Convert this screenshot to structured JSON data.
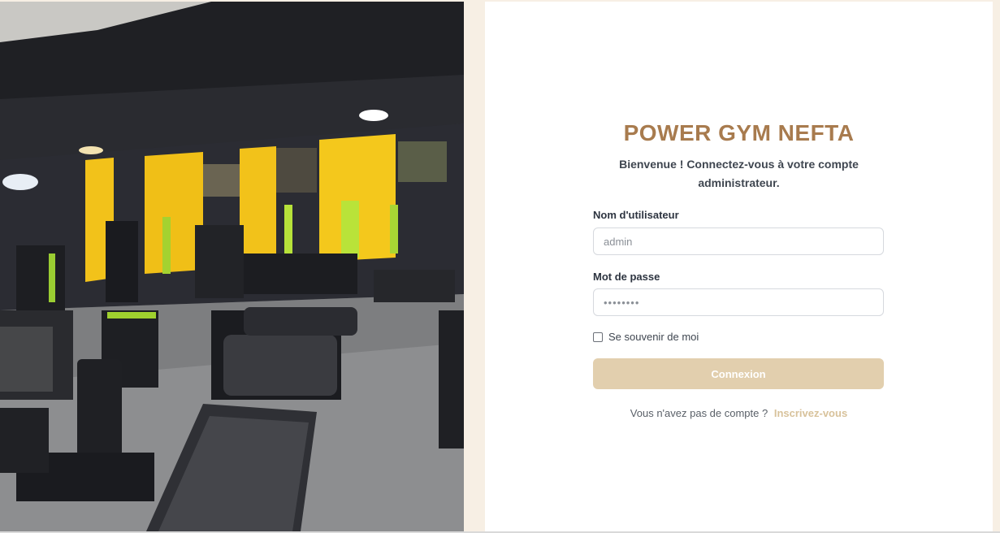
{
  "brand": {
    "title": "POWER GYM NEFTA"
  },
  "welcome": {
    "text": "Bienvenue ! Connectez-vous à votre compte administrateur."
  },
  "form": {
    "username_label": "Nom d'utilisateur",
    "username_value": "admin",
    "password_label": "Mot de passe",
    "password_value": "••••••••",
    "remember_label": "Se souvenir de moi",
    "remember_checked": false,
    "submit_label": "Connexion"
  },
  "signup": {
    "prompt": "Vous n'avez pas de compte ?",
    "link_label": "Inscrivez-vous"
  },
  "colors": {
    "brand": "#a87b4e",
    "button": "#e2cfae",
    "link": "#d8c29b",
    "background": "#f7efe4"
  },
  "image": {
    "subject": "gym interior photo"
  }
}
